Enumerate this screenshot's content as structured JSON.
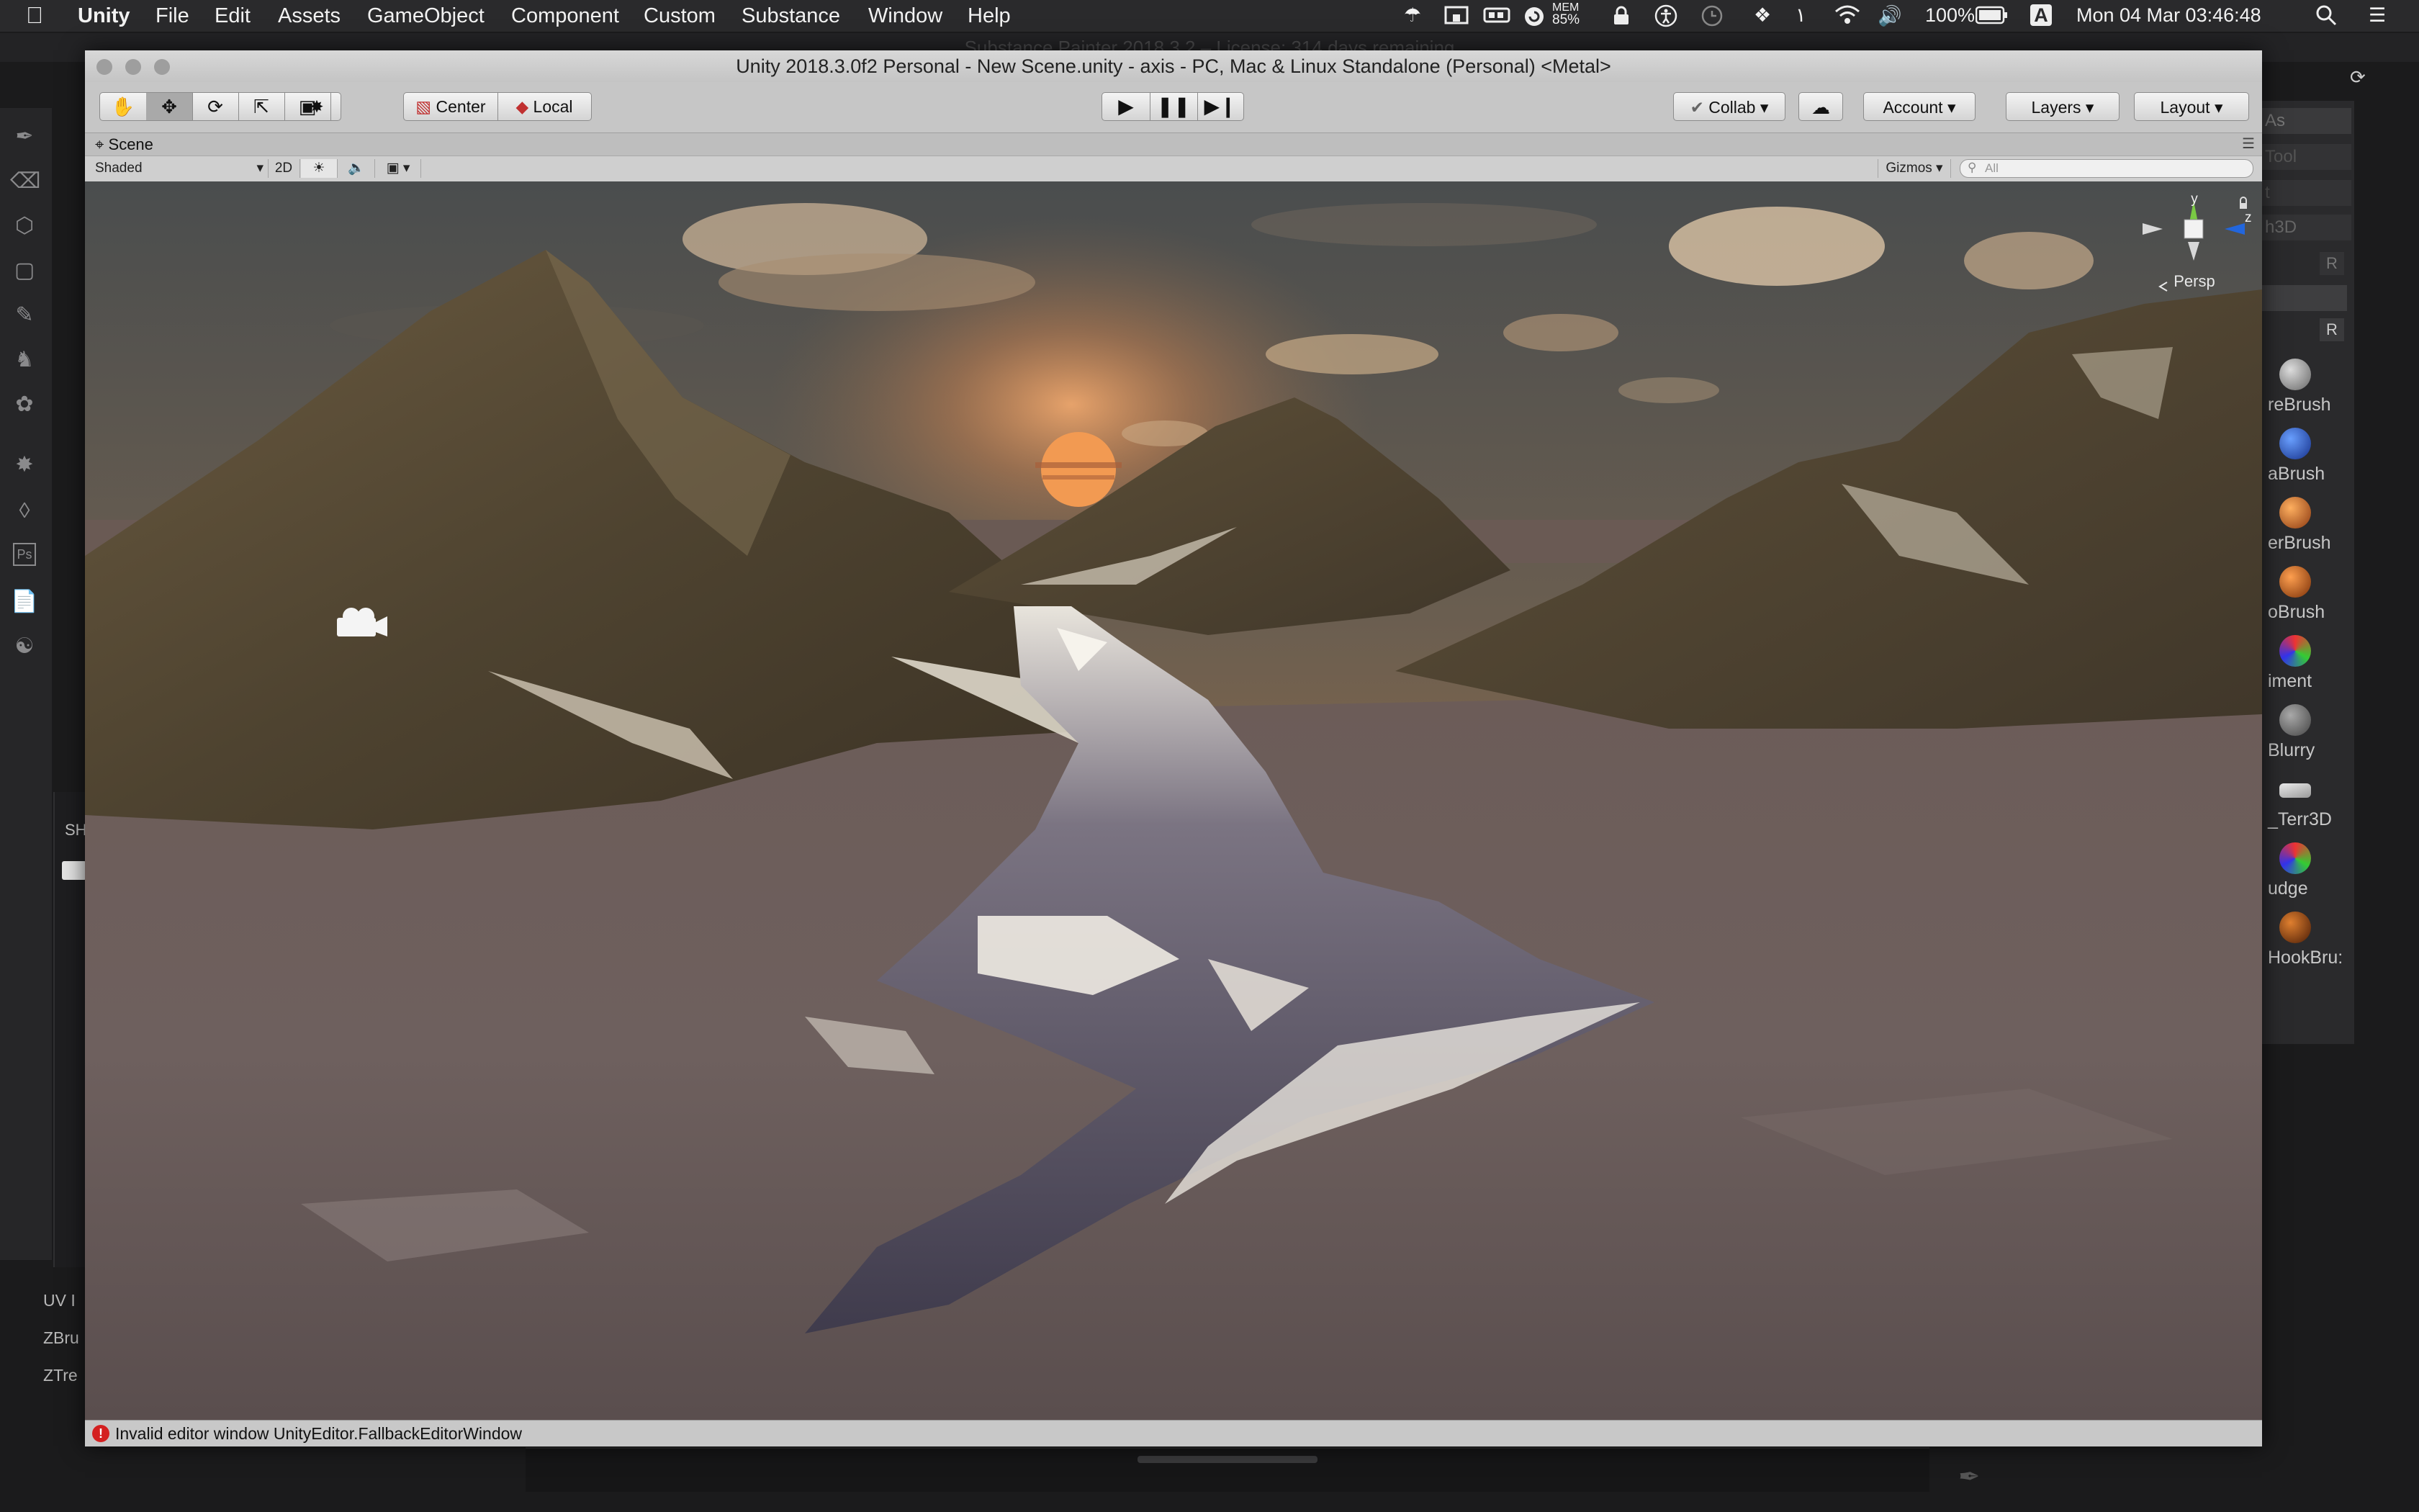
{
  "menubar": {
    "app_name": "Unity",
    "items": [
      "File",
      "Edit",
      "Assets",
      "GameObject",
      "Component",
      "Custom",
      "Substance",
      "Window",
      "Help"
    ],
    "status": {
      "mem_label": "MEM",
      "mem_value": "85%",
      "battery": "100%",
      "input_source": "A",
      "datetime": "Mon 04 Mar  03:46:48"
    }
  },
  "background_app": {
    "title": "Substance Painter 2018.3.2 – License: 314 days remaining",
    "bottom_items": [
      "UV I",
      "ZBru",
      "ZTre"
    ],
    "panel_header": "SH",
    "right_panel": {
      "top_labels": [
        "As",
        "Tool",
        "t",
        "h3D"
      ],
      "r_button": "R",
      "brushes": [
        "reBrush",
        "aBrush",
        "erBrush",
        "oBrush",
        "iment",
        "Blurry",
        "_Terr3D",
        "udge",
        "HookBru:"
      ]
    }
  },
  "window": {
    "title": "Unity 2018.3.0f2 Personal - New Scene.unity - axis - PC, Mac & Linux Standalone (Personal) <Metal>"
  },
  "toolbar": {
    "pivot_mode": "Center",
    "pivot_rotation": "Local",
    "collab": "Collab",
    "account": "Account",
    "layers": "Layers",
    "layout": "Layout"
  },
  "scene_tab": {
    "label": "Scene"
  },
  "scene_toolbar": {
    "draw_mode": "Shaded",
    "mode_2d": "2D",
    "gizmos": "Gizmos",
    "search_placeholder": "All"
  },
  "scene_gizmo": {
    "y": "y",
    "z": "z",
    "projection": "Persp"
  },
  "status_bar": {
    "message": "Invalid editor window UnityEditor.FallbackEditorWindow"
  },
  "colors": {
    "accent_play": "#111111",
    "error_red": "#d42020",
    "gizmo_y": "#7ac943",
    "gizmo_z": "#2266dd"
  }
}
